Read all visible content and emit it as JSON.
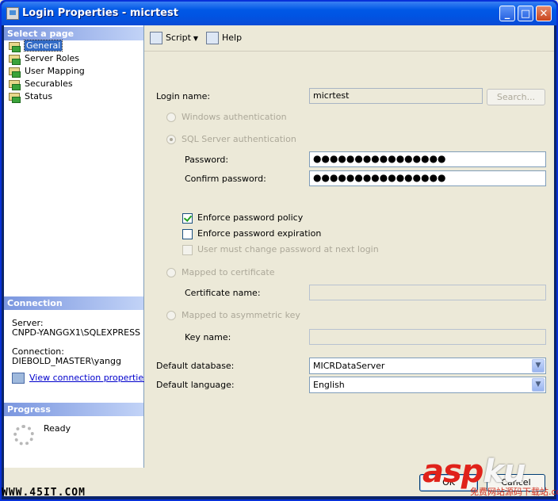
{
  "window": {
    "title": "Login Properties - micrtest",
    "min": "_",
    "max": "□",
    "close": "✕"
  },
  "left": {
    "select_page_header": "Select a page",
    "pages": [
      "General",
      "Server Roles",
      "User Mapping",
      "Securables",
      "Status"
    ],
    "selected_page": "General",
    "connection_header": "Connection",
    "server_label": "Server:",
    "server_value": "CNPD-YANGGX1\\SQLEXPRESS",
    "connection_label": "Connection:",
    "connection_value": "DIEBOLD_MASTER\\yangg",
    "view_connection_properties": "View connection properties",
    "progress_header": "Progress",
    "progress_status": "Ready"
  },
  "toolbar": {
    "script_label": "Script",
    "help_label": "Help"
  },
  "form": {
    "login_name_label": "Login name:",
    "login_name_value": "micrtest",
    "search_button": "Search...",
    "windows_auth": "Windows authentication",
    "sql_auth": "SQL Server authentication",
    "password_label": "Password:",
    "password_value": "●●●●●●●●●●●●●●●●",
    "confirm_password_label": "Confirm password:",
    "confirm_password_value": "●●●●●●●●●●●●●●●●",
    "enforce_policy": "Enforce password policy",
    "enforce_expiration": "Enforce password expiration",
    "must_change": "User must change password at next login",
    "mapped_cert": "Mapped to certificate",
    "cert_name_label": "Certificate name:",
    "mapped_asym": "Mapped to asymmetric key",
    "key_name_label": "Key name:",
    "default_db_label": "Default database:",
    "default_db_value": "MICRDataServer",
    "default_lang_label": "Default language:",
    "default_lang_value": "English"
  },
  "buttons": {
    "ok": "OK",
    "cancel": "Cancel"
  },
  "watermarks": {
    "site": "WWW.45IT.COM",
    "brand_a": "asp",
    "brand_b": "ku",
    "brand_sub": "免费网站源码下载站",
    "brand_domain": ".com"
  }
}
